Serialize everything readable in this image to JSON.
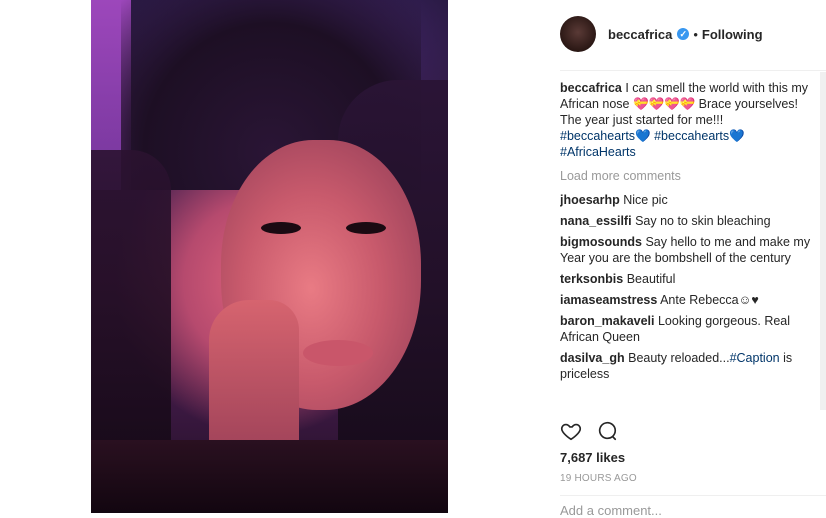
{
  "header": {
    "username": "beccafrica",
    "verified_mark": "✓",
    "separator": "•",
    "follow_state": "Following"
  },
  "caption": {
    "username": "beccafrica",
    "text": "I can smell the world with this my African nose 💝💝💝💝 Brace yourselves! The year just started for me!!!",
    "tags": [
      "#beccahearts💙",
      "#beccahearts💙",
      "#AfricaHearts"
    ]
  },
  "load_more": "Load more comments",
  "comments": [
    {
      "user": "jhoesarhp",
      "text": "Nice pic"
    },
    {
      "user": "nana_essilfi",
      "text": "Say no to skin bleaching"
    },
    {
      "user": "bigmosounds",
      "text": "Say hello to me and make my Year you are the bombshell of the century"
    },
    {
      "user": "terksonbis",
      "text": "Beautiful"
    },
    {
      "user": "iamaseamstress",
      "text": "Ante Rebecca☺♥"
    },
    {
      "user": "baron_makaveli",
      "text": "Looking gorgeous. Real African Queen"
    },
    {
      "user": "dasilva_gh",
      "text": "Beauty reloaded...",
      "tag": "#Caption",
      "text_after": " is priceless"
    }
  ],
  "actions": {
    "like_icon": "heart-icon",
    "comment_icon": "comment-icon"
  },
  "likes": "7,687 likes",
  "timestamp": "19 HOURS AGO",
  "add_comment_placeholder": "Add a comment..."
}
